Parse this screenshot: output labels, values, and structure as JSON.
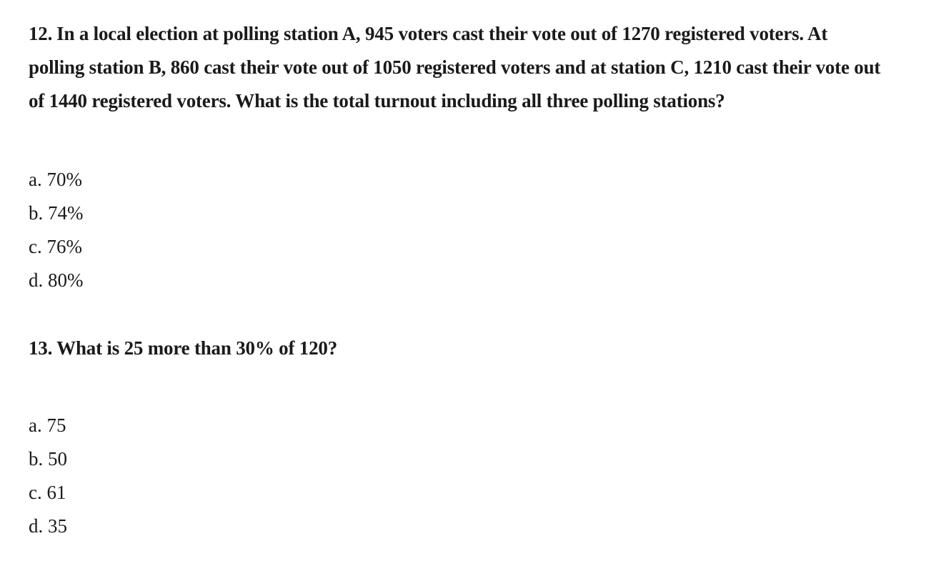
{
  "questions": [
    {
      "number": "12.",
      "text": "In a local election at polling station A, 945 voters cast their vote out of 1270 registered voters. At polling station B, 860 cast their vote out of 1050 registered voters and at station C, 1210 cast their vote out of 1440 registered voters. What is the total turnout including all three polling stations?",
      "options": [
        "a. 70%",
        "b. 74%",
        "c. 76%",
        "d. 80%"
      ]
    },
    {
      "number": "13.",
      "text": "What is 25 more than 30% of 120?",
      "options": [
        "a. 75",
        "b. 50",
        "c. 61",
        "d. 35"
      ]
    }
  ]
}
